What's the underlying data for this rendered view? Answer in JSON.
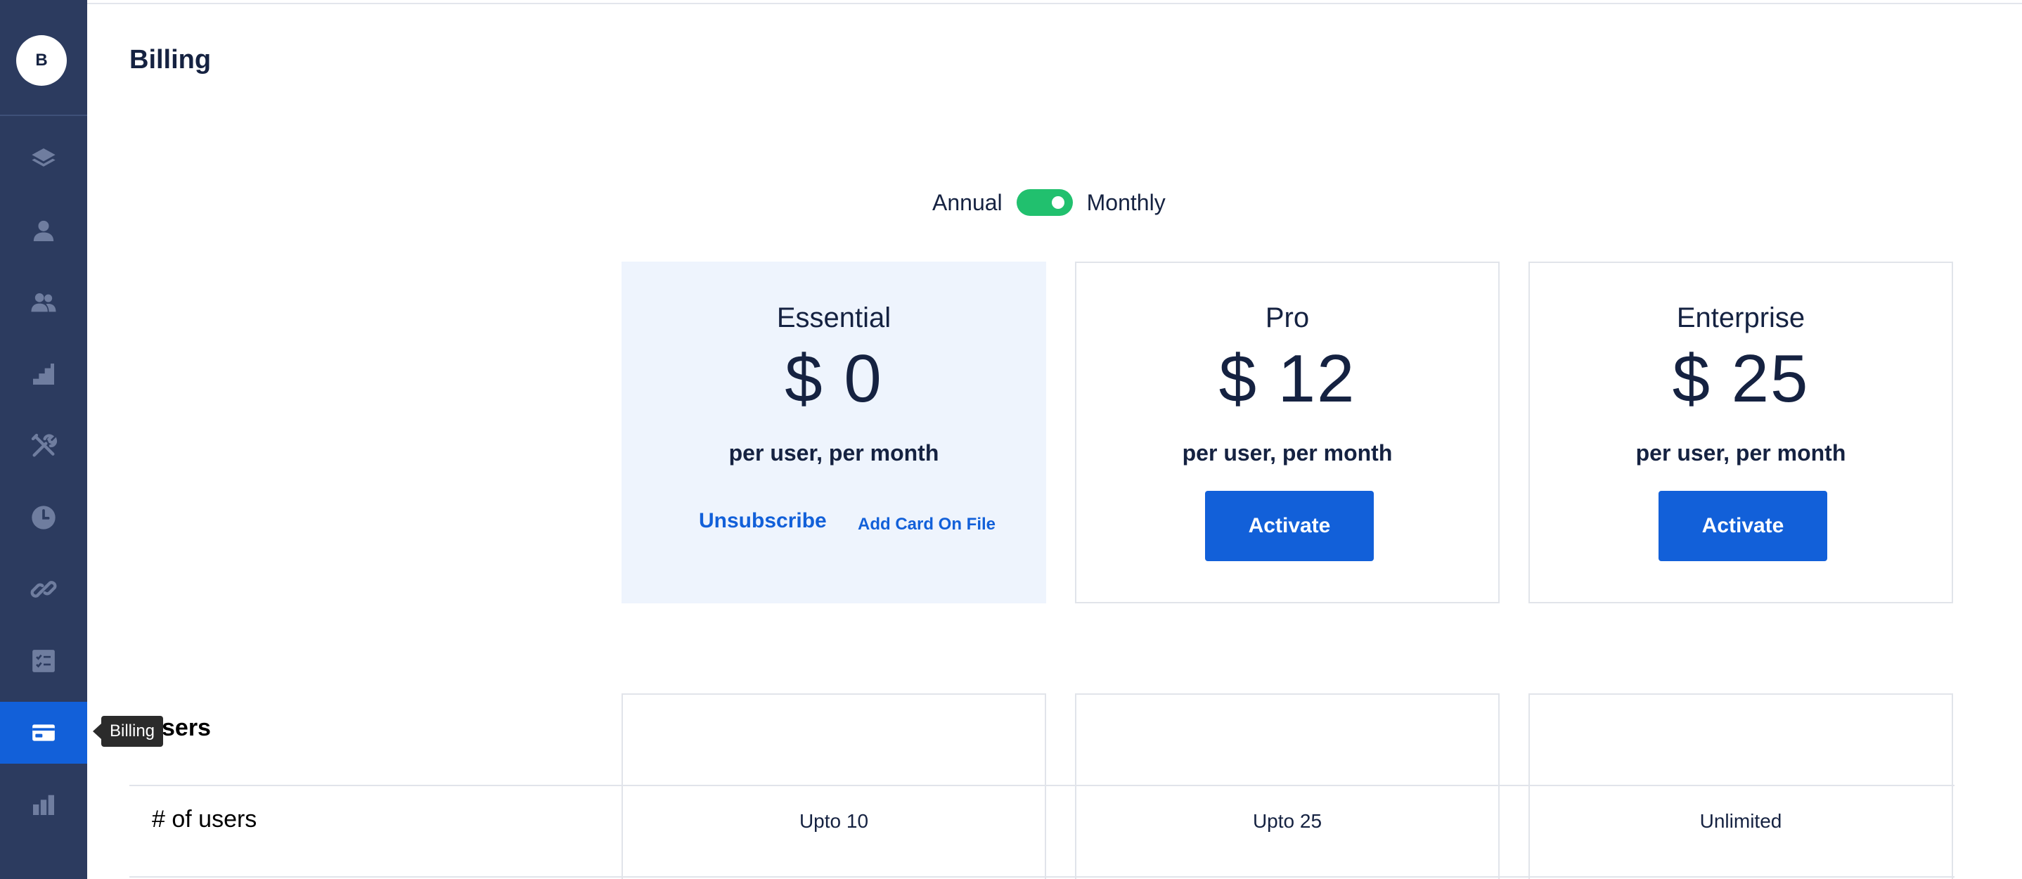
{
  "sidebar": {
    "avatar_initial": "B",
    "items": [
      {
        "name": "layers-icon"
      },
      {
        "name": "user-icon"
      },
      {
        "name": "users-icon"
      },
      {
        "name": "stairs-icon"
      },
      {
        "name": "tools-icon"
      },
      {
        "name": "clock-icon"
      },
      {
        "name": "link-icon"
      },
      {
        "name": "checklist-icon"
      },
      {
        "name": "billing-card-icon",
        "active": true
      },
      {
        "name": "bar-chart-icon"
      }
    ],
    "tooltip": "Billing"
  },
  "page": {
    "title": "Billing"
  },
  "billing_toggle": {
    "left_label": "Annual",
    "right_label": "Monthly",
    "state": "monthly"
  },
  "plans": [
    {
      "name": "Essential",
      "price": "$ 0",
      "period": "per user, per month",
      "primary_action": "Unsubscribe",
      "secondary_action": "Add Card On File",
      "current": true
    },
    {
      "name": "Pro",
      "price": "$ 12",
      "period": "per user, per month",
      "action": "Activate"
    },
    {
      "name": "Enterprise",
      "price": "$ 25",
      "period": "per user, per month",
      "action": "Activate"
    }
  ],
  "features": {
    "section_label": "sers",
    "rows": [
      {
        "label": "# of users",
        "values": [
          "Upto 10",
          "Upto 25",
          "Unlimited"
        ]
      }
    ]
  },
  "colors": {
    "sidebar_bg": "#2c3b5f",
    "accent": "#1260d9",
    "toggle_on": "#21c06e",
    "highlight_card": "#eef4fd",
    "text_dark": "#152241"
  }
}
